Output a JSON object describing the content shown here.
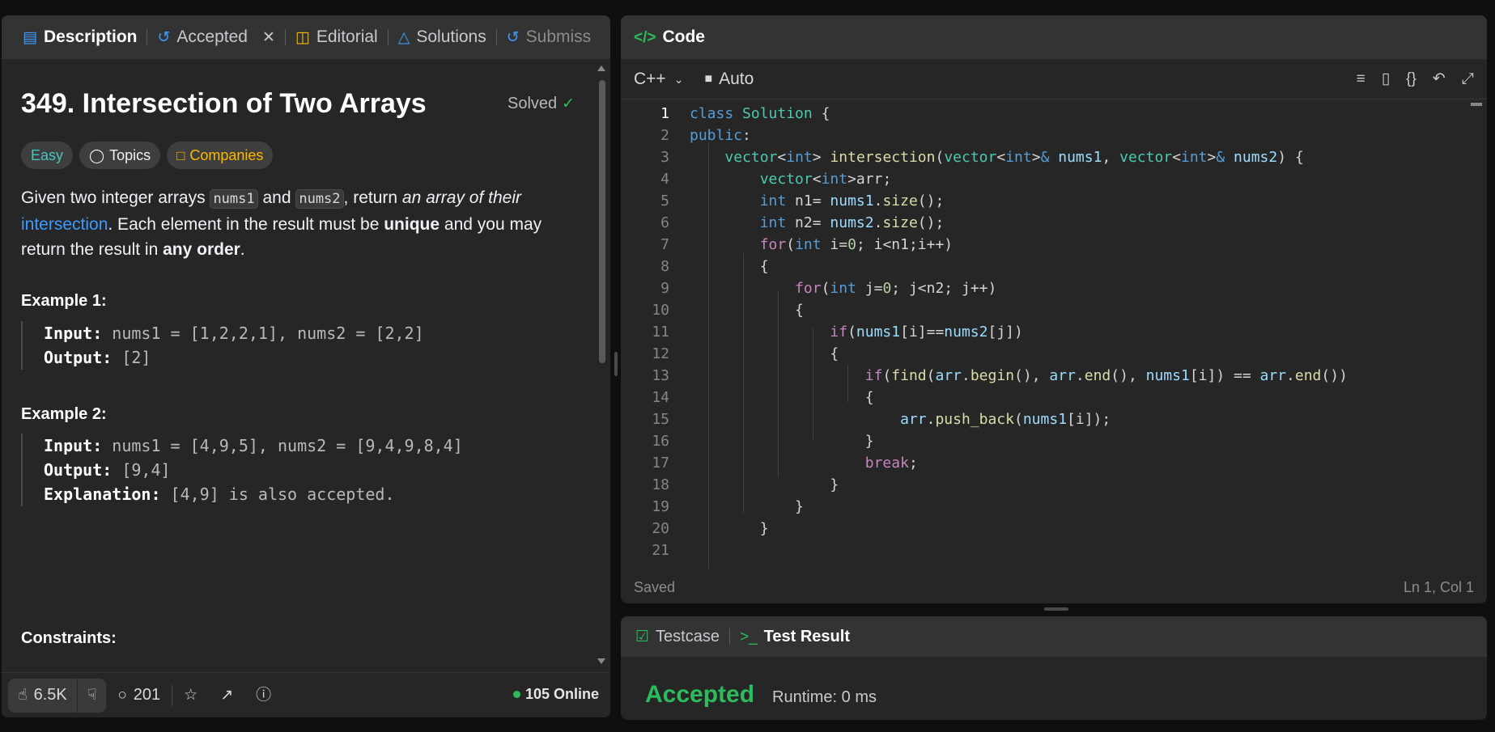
{
  "left_tabs": [
    {
      "label": "Description",
      "icon": "description-icon"
    },
    {
      "label": "Accepted",
      "icon": "history-icon"
    },
    {
      "label": "Editorial",
      "icon": "book-icon"
    },
    {
      "label": "Solutions",
      "icon": "flask-icon"
    },
    {
      "label": "Submiss",
      "icon": "history-icon"
    }
  ],
  "problem": {
    "title": "349. Intersection of Two Arrays",
    "status": "Solved",
    "difficulty": "Easy",
    "topics_label": "Topics",
    "companies_label": "Companies",
    "desc_1": "Given two integer arrays ",
    "code_1": "nums1",
    "desc_2": " and ",
    "code_2": "nums2",
    "desc_3": ", return ",
    "desc_4_italic": "an array of their",
    "link": "intersection",
    "desc_5": ". Each element in the result must be ",
    "bold_1": "unique",
    "desc_6": " and you may return the result in ",
    "bold_2": "any order",
    "desc_7": "."
  },
  "examples": [
    {
      "title": "Example 1:",
      "input_label": "Input:",
      "input": " nums1 = [1,2,2,1], nums2 = [2,2]",
      "output_label": "Output:",
      "output": " [2]"
    },
    {
      "title": "Example 2:",
      "input_label": "Input:",
      "input": " nums1 = [4,9,5], nums2 = [9,4,9,8,4]",
      "output_label": "Output:",
      "output": " [9,4]",
      "explanation_label": "Explanation:",
      "explanation": " [4,9] is also accepted."
    }
  ],
  "constraints_title": "Constraints:",
  "footer": {
    "likes": "6.5K",
    "comments": "201",
    "online": "105 Online"
  },
  "code_panel": {
    "title": "Code",
    "language": "C++",
    "mode": "Auto",
    "status": "Saved",
    "cursor": "Ln 1, Col 1"
  },
  "code_lines": [
    "1",
    "2",
    "3",
    "4",
    "5",
    "6",
    "7",
    "8",
    "9",
    "10",
    "11",
    "12",
    "13",
    "14",
    "15",
    "16",
    "17",
    "18",
    "19",
    "20",
    "21"
  ],
  "test_panel": {
    "testcase_label": "Testcase",
    "result_label": "Test Result",
    "verdict": "Accepted",
    "runtime": "Runtime: 0 ms"
  },
  "colors": {
    "accent_green": "#2cbb5d",
    "easy": "#46c6c2",
    "companies": "#ffb800",
    "link": "#3d9bff"
  }
}
